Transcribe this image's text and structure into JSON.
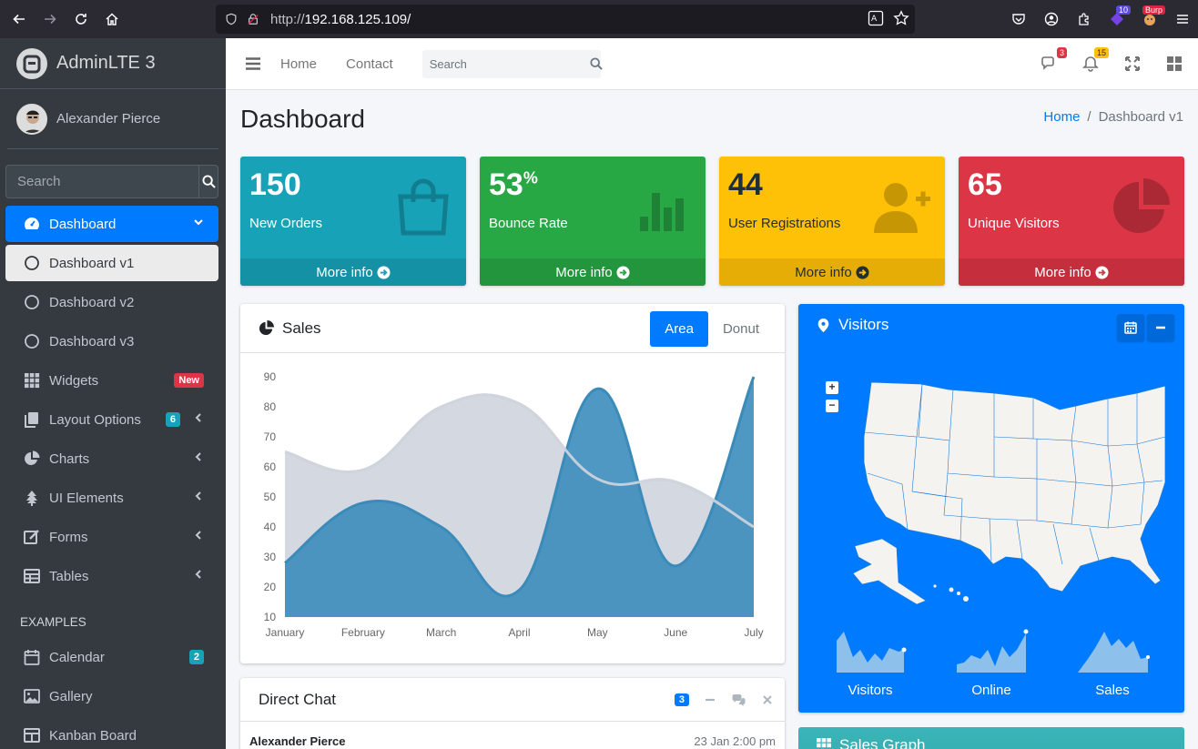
{
  "browser": {
    "url_prefix": "http://",
    "url_host": "192.168.125.109/",
    "ext_badge_1": "10",
    "ext_badge_2": "Burp"
  },
  "sidebar": {
    "brand": "AdminLTE 3",
    "user_name": "Alexander Pierce",
    "search_placeholder": "Search",
    "items": [
      {
        "label": "Dashboard"
      },
      {
        "label": "Dashboard v1"
      },
      {
        "label": "Dashboard v2"
      },
      {
        "label": "Dashboard v3"
      },
      {
        "label": "Widgets",
        "badge": "New"
      },
      {
        "label": "Layout Options",
        "badge": "6"
      },
      {
        "label": "Charts"
      },
      {
        "label": "UI Elements"
      },
      {
        "label": "Forms"
      },
      {
        "label": "Tables"
      }
    ],
    "examples_header": "EXAMPLES",
    "examples": [
      {
        "label": "Calendar",
        "badge": "2"
      },
      {
        "label": "Gallery"
      },
      {
        "label": "Kanban Board"
      }
    ]
  },
  "topnav": {
    "home": "Home",
    "contact": "Contact",
    "search_placeholder": "Search",
    "messages_badge": "3",
    "notifications_badge": "15"
  },
  "page": {
    "title": "Dashboard",
    "breadcrumb_home": "Home",
    "breadcrumb_current": "Dashboard v1"
  },
  "boxes": [
    {
      "value": "150",
      "suffix": "",
      "label": "New Orders",
      "link": "More info",
      "color": "#17a2b8"
    },
    {
      "value": "53",
      "suffix": "%",
      "label": "Bounce Rate",
      "link": "More info",
      "color": "#28a745"
    },
    {
      "value": "44",
      "suffix": "",
      "label": "User Registrations",
      "link": "More info",
      "color": "#ffc107"
    },
    {
      "value": "65",
      "suffix": "",
      "label": "Unique Visitors",
      "link": "More info",
      "color": "#dc3545"
    }
  ],
  "sales": {
    "title": "Sales",
    "tab_area": "Area",
    "tab_donut": "Donut"
  },
  "chart_data": {
    "type": "area",
    "categories": [
      "January",
      "February",
      "March",
      "April",
      "May",
      "June",
      "July"
    ],
    "ylim": [
      10,
      90
    ],
    "yticks": [
      10,
      20,
      30,
      40,
      50,
      60,
      70,
      80,
      90
    ],
    "series": [
      {
        "values": [
          65,
          59,
          80,
          81,
          56,
          55,
          40
        ],
        "color": "#d2d6de"
      },
      {
        "values": [
          28,
          48,
          40,
          19,
          86,
          27,
          90
        ],
        "color": "#3c8dbc"
      }
    ]
  },
  "visitors": {
    "title": "Visitors",
    "sparklines": [
      {
        "label": "Visitors"
      },
      {
        "label": "Online"
      },
      {
        "label": "Sales"
      }
    ]
  },
  "chat": {
    "title": "Direct Chat",
    "badge": "3",
    "first_name": "Alexander Pierce",
    "first_time": "23 Jan 2:00 pm"
  },
  "sales_graph": {
    "title": "Sales Graph"
  },
  "colors": {
    "primary": "#007bff",
    "sidebar": "#343a40"
  }
}
